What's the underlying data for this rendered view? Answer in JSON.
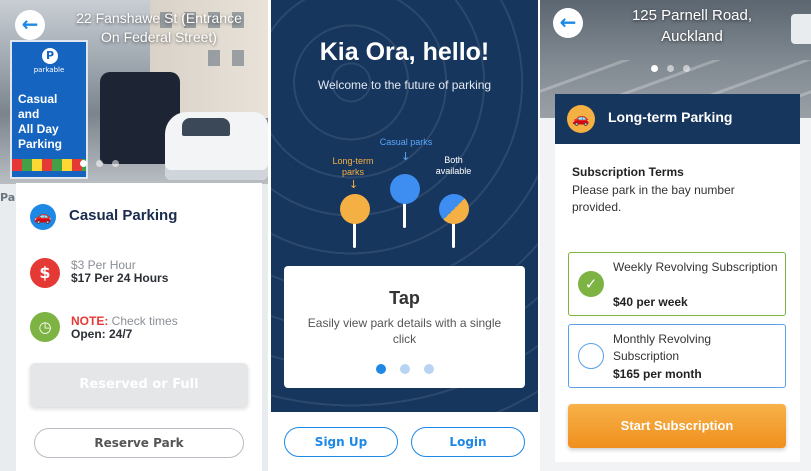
{
  "colors": {
    "navy": "#17365d",
    "accent_blue": "#1e88e5",
    "orange": "#f4b042",
    "green": "#7cb342",
    "red": "#e53935"
  },
  "screen1": {
    "hero_title": "22 Fanshawe St (Entrance\nOn Federal Street)",
    "sign_brand": "parkable",
    "sign_text": "Casual and\nAll Day\nParking",
    "edge_label": "Park",
    "back_icon": "arrow-left-icon",
    "card_icon": "car-icon",
    "card_title": "Casual Parking",
    "price_icon": "dollar-icon",
    "price_line1": "$3 Per Hour",
    "price_line2": "$17 Per 24 Hours",
    "hours_icon": "clock-icon",
    "note_label": "NOTE:",
    "note_text": " Check times",
    "open_text": "Open: 24/7",
    "disabled_button": "Reserved or Full",
    "reserve_button": "Reserve Park"
  },
  "screen2": {
    "title": "Kia Ora, hello!",
    "subtitle": "Welcome to the future of parking",
    "labels": {
      "long_term": "Long-term\nparks",
      "casual": "Casual parks",
      "both": "Both\navailable"
    },
    "tap_title": "Tap",
    "tap_text": "Easily view park details with a single click",
    "signup_button": "Sign Up",
    "login_button": "Login"
  },
  "screen3": {
    "hero_title": "125 Parnell Road,\nAuckland",
    "back_icon": "arrow-left-icon",
    "header_icon": "car-icon",
    "header_title": "Long-term Parking",
    "terms_title": "Subscription Terms",
    "terms_text": "Please park in the bay number provided.",
    "options": [
      {
        "name": "Weekly Revolving Subscription",
        "price": "$40 per week",
        "selected": true
      },
      {
        "name": "Monthly Revolving Subscription",
        "price": "$165 per month",
        "selected": false
      }
    ],
    "start_button": "Start Subscription"
  }
}
